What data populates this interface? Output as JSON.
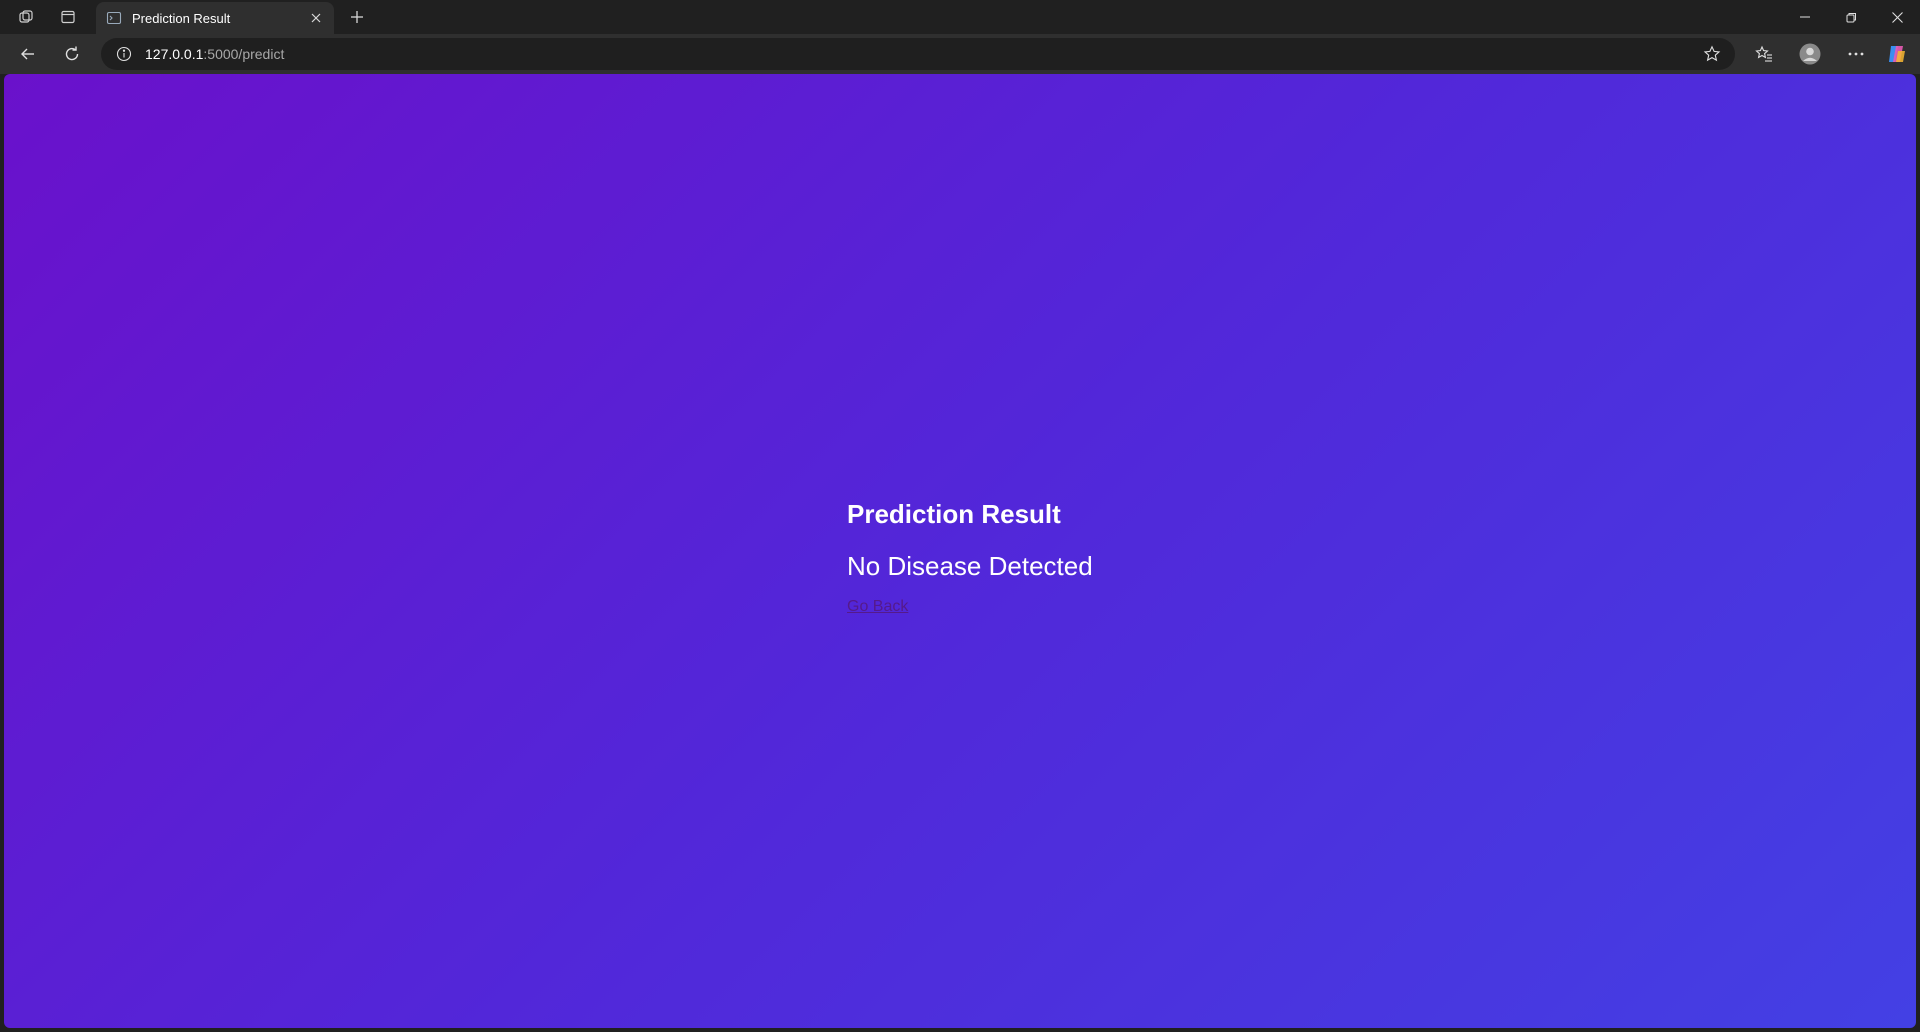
{
  "browser": {
    "tab_title": "Prediction Result",
    "url_host": "127.0.0.1",
    "url_path": ":5000/predict"
  },
  "page": {
    "heading": "Prediction Result",
    "prediction": "No Disease Detected",
    "back_link": "Go Back"
  },
  "colors": {
    "gradient_start": "#6a11cb",
    "gradient_end": "#4340e4",
    "link": "#551a8b"
  }
}
